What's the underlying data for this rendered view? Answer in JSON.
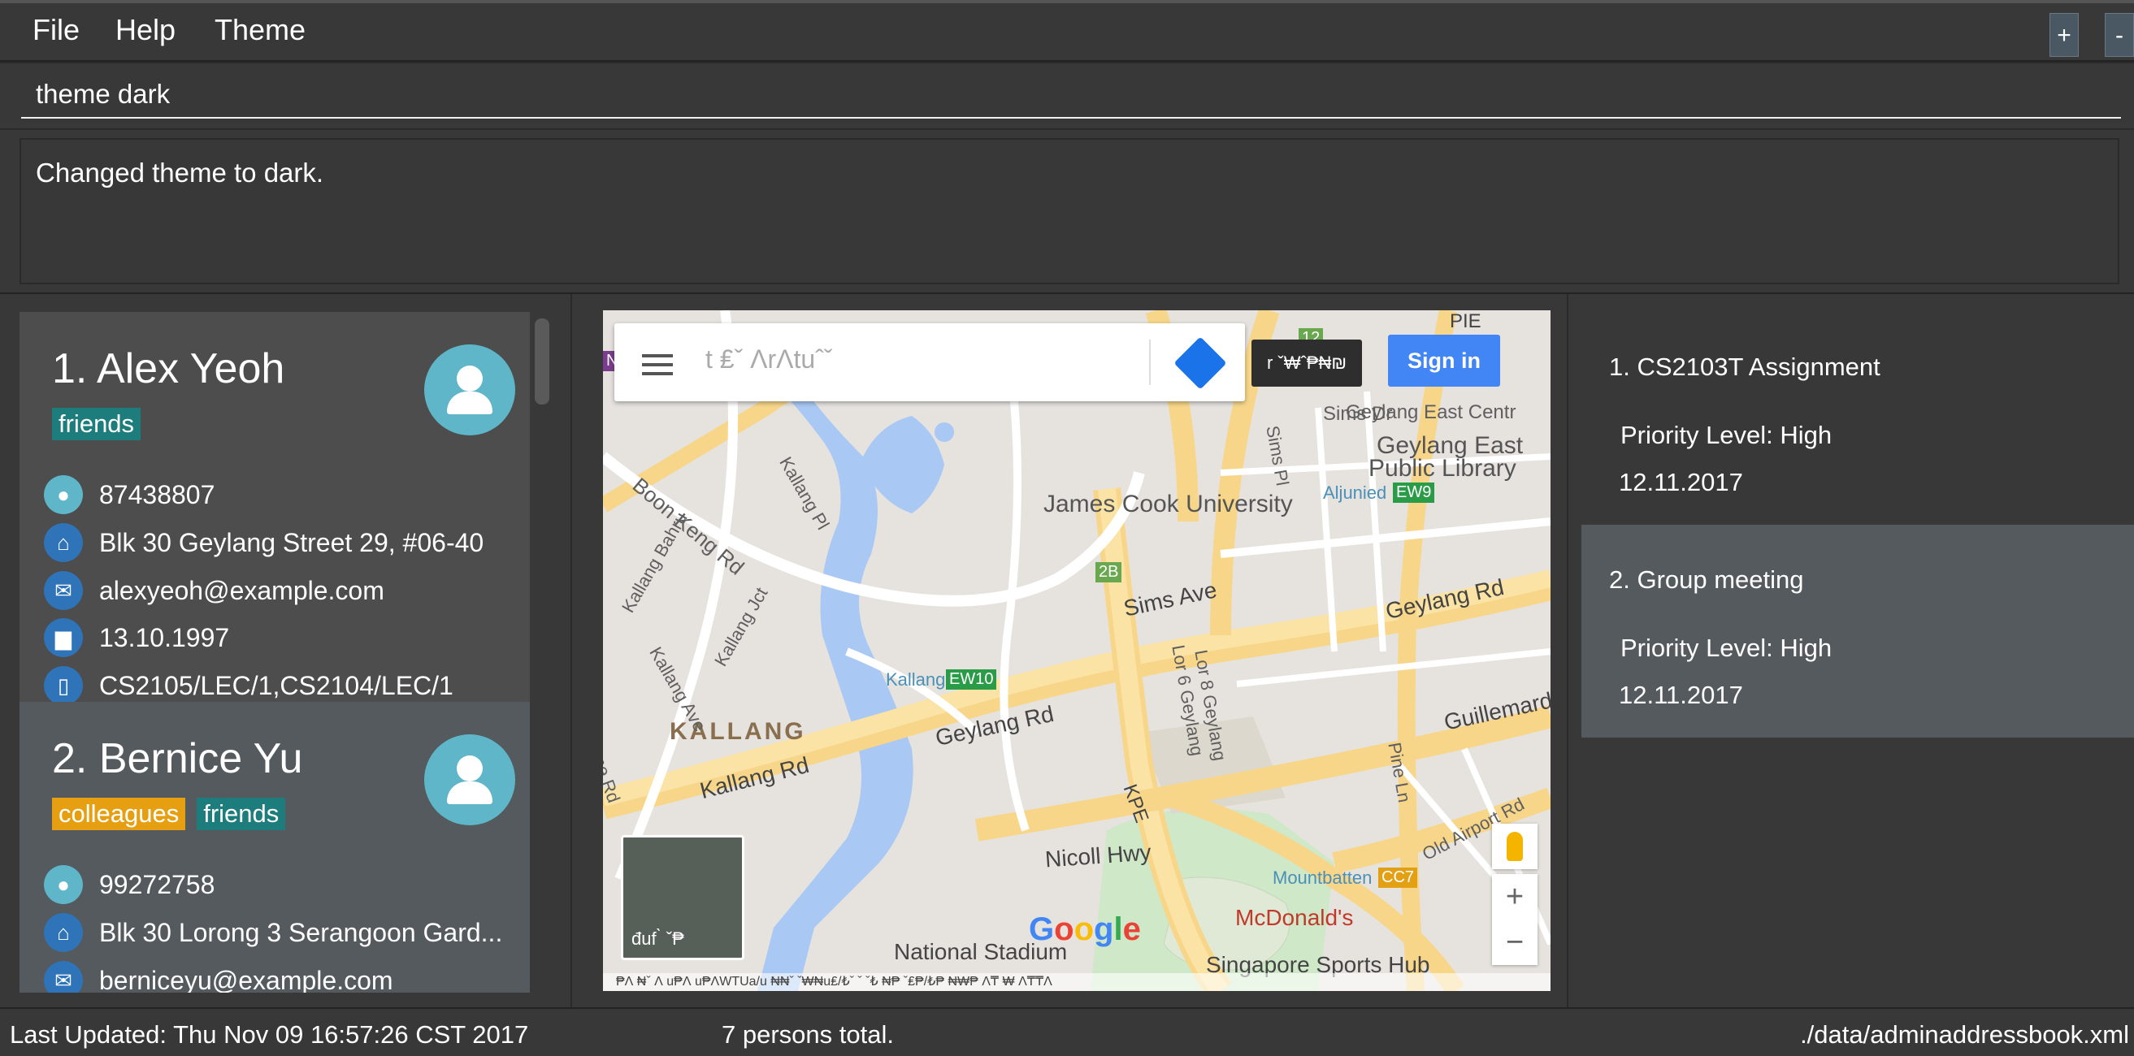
{
  "menu": {
    "file": "File",
    "help": "Help",
    "theme": "Theme"
  },
  "window_buttons": {
    "add": "+",
    "minus": "-"
  },
  "command": {
    "value": "theme dark"
  },
  "result": {
    "text": "Changed theme to dark."
  },
  "persons": [
    {
      "name": "1. Alex Yeoh",
      "tags": [
        "friends"
      ],
      "phone": "87438807",
      "address": "Blk 30 Geylang Street 29, #06-40",
      "email": "alexyeoh@example.com",
      "birthday": "13.10.1997",
      "modules": "CS2105/LEC/1,CS2104/LEC/1"
    },
    {
      "name": "2. Bernice Yu",
      "tags": [
        "colleagues",
        "friends"
      ],
      "phone": "99272758",
      "address": "Blk 30 Lorong 3 Serangoon Gard...",
      "email": "berniceyu@example.com"
    }
  ],
  "map": {
    "search_placeholder": "t ₤ˇ ɅrɅtuˆˇ",
    "directions_tooltip": "r ˇ₩ˆ₱₦₪",
    "sign_in": "Sign in",
    "satellite_label": "đuf ̀ ˇ₱",
    "google": "Google",
    "labels": {
      "james_cook": "James Cook University",
      "geylang_east_lib": "Geylang East",
      "geylang_east_lib2": "Public Library",
      "geylang_east_centre": "Geylang East Centr",
      "sims_dr": "Sims Dr",
      "sims_pl": "Sims Pl",
      "aljunied": "Aljunied",
      "sims_ave": "Sims Ave",
      "geylang_rd_right": "Geylang Rd",
      "geylang_rd_mid": "Geylang Rd",
      "kallang": "KALLANG",
      "kallang_rd": "Kallang Rd",
      "kallang_mrt": "Kallang",
      "boon_keng": "Boon Keng Rd",
      "kallang_pl": "Kallang Pl",
      "kallang_bahru": "Kallang Bahru",
      "kallang_ave": "Kallang Ave",
      "kallang_jct": "Kallang Jct",
      "lor6": "Lor 6 Geylang",
      "lor8": "Lor 8 Geylang",
      "kpe": "KPE",
      "nicoll": "Nicoll Hwy",
      "national_stadium": "National Stadium",
      "mountbatten": "Mountbatten",
      "mcdonalds": "McDonald's",
      "sports_hub": "Singapore Sports Hub",
      "guillemard": "Guillemard",
      "pine_ln": "Pine Ln",
      "old_airport": "Old Airport Rd",
      "ame_rd": "me Rd",
      "pie": "PIE"
    },
    "badges": {
      "ew9": "EW9",
      "ew10": "EW10",
      "cc7": "CC7",
      "b2b": "2B",
      "b12": "12",
      "ne": "NE"
    },
    "footer": "₱Ʌ ₦ˇ   Ʌ u₱Ʌ u₱ɅWTUa/u ₦₦ˇ ˇ₩₦u₤/₺ˇ ˇ ˇ₺ ₦₱ ˇ₤₱/₺₱ ₦₩₱      Ʌ₸ ₩     Ʌ₸₸Ʌ"
  },
  "tasks": [
    {
      "title": "1. CS2103T Assignment",
      "priority": "Priority Level: High",
      "date": "12.11.2017"
    },
    {
      "title": "2. Group meeting",
      "priority": "Priority Level: High",
      "date": "12.11.2017"
    }
  ],
  "status": {
    "last_updated": "Last Updated: Thu Nov 09 16:57:26 CST 2017",
    "total": "7 persons total.",
    "path": "./data/adminaddressbook.xml"
  },
  "colors": {
    "tag_friends": "#1d7c7c",
    "tag_colleagues": "#e79f12",
    "sign_in": "#4285f4"
  }
}
